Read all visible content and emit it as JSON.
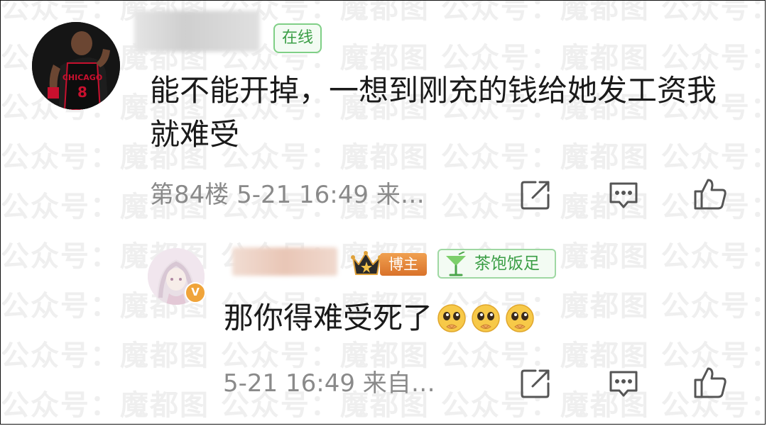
{
  "watermark": {
    "text": "公众号：魔都图",
    "rows": [
      "公众号：魔都图 公众号：魔都图 公众号：魔都图 公众号：魔都图 公众号：魔都图 公众号：魔都图",
      "公众号：魔都图 公众号：魔都图 公众号：魔都图 公众号：魔都图 公众号：魔都图 公众号：魔都图",
      "公众号：魔都图 公众号：魔都图 公众号：魔都图 公众号：魔都图 公众号：魔都图 公众号：魔都图",
      "公众号：魔都图 公众号：魔都图 公众号：魔都图 公众号：魔都图 公众号：魔都图 公众号：魔都图",
      "公众号：魔都图 公众号：魔都图 公众号：魔都图 公众号：魔都图 公众号：魔都图 公众号：魔都图",
      "公众号：魔都图 公众号：魔都图 公众号：魔都图 公众号：魔都图 公众号：魔都图 公众号：魔都图",
      "公众号：魔都图 公众号：魔都图 公众号：魔都图 公众号：魔都图 公众号：魔都图 公众号：魔都图",
      "公众号：魔都图 公众号：魔都图 公众号：魔都图 公众号：魔都图 公众号：魔都图 公众号：魔都图",
      "公众号：魔都图 公众号：魔都图 公众号：魔都图 公众号：魔都图 公众号：魔都图 公众号：魔都图"
    ]
  },
  "comments": [
    {
      "status_badge": "在线",
      "avatar_jersey_text": "CHICAGO",
      "avatar_jersey_number": "8",
      "text": "能不能开掉，一想到刚充的钱给她发工资我就难受",
      "meta": "第84楼 5-21 16:49 来…",
      "icons": [
        "share-icon",
        "comment-icon",
        "like-icon"
      ]
    },
    {
      "verified_badge": "V",
      "author_badge": "博主",
      "fan_badge": "茶饱饭足",
      "text": "那你得难受死了",
      "emoji": [
        "pleading-face-emoji",
        "pleading-face-emoji",
        "pleading-face-emoji"
      ],
      "meta": "5-21 16:49 来自…",
      "icons": [
        "share-icon",
        "comment-icon",
        "like-icon"
      ]
    }
  ],
  "colors": {
    "text": "#1a1a1a",
    "meta": "#8a8a8a",
    "green_badge": "#3a9e45",
    "orange_badge": "#d9722a",
    "verified": "#f0a43a"
  }
}
